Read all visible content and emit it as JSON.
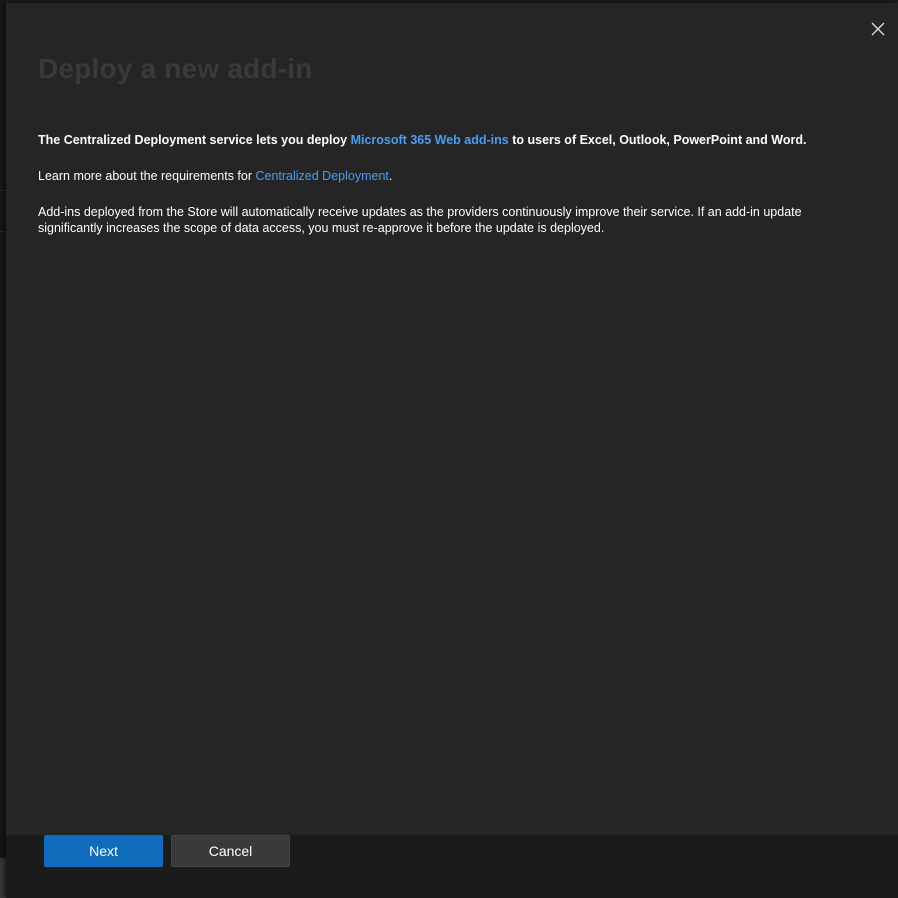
{
  "panel": {
    "title": "Deploy a new add-in",
    "close_icon": "close-icon"
  },
  "content": {
    "p1_before": "The Centralized Deployment service lets you deploy ",
    "p1_link": "Microsoft 365 Web add-ins",
    "p1_after": " to users of Excel, Outlook, PowerPoint and Word.",
    "p2_before": "Learn more about the requirements for ",
    "p2_link": "Centralized Deployment",
    "p2_after": ".",
    "p3": "Add-ins deployed from the Store will automatically receive updates as the providers continuously improve their service. If an add-in update significantly increases the scope of data access, you must re-approve it before the update is deployed."
  },
  "footer": {
    "next_label": "Next",
    "cancel_label": "Cancel"
  },
  "colors": {
    "accent": "#0f6cbd",
    "link": "#479ef5",
    "panel_bg": "#252526",
    "footer_bg": "#1b1b1b"
  }
}
